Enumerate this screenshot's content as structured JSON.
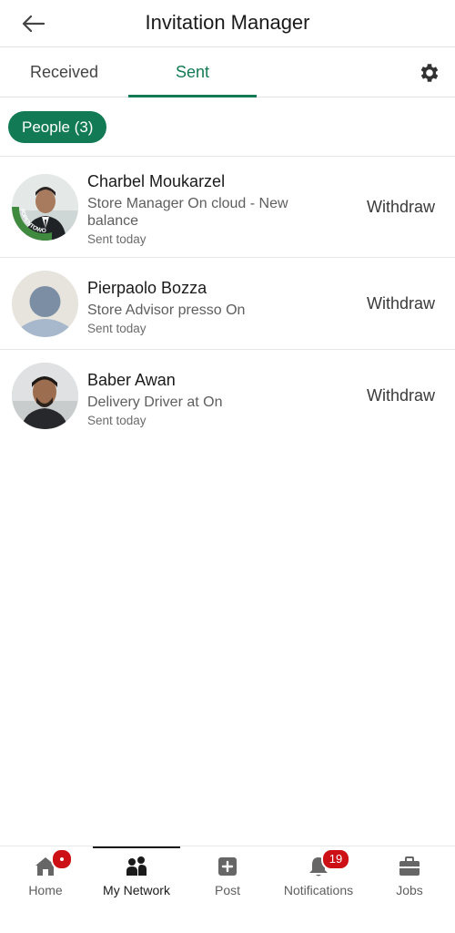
{
  "header": {
    "title": "Invitation Manager",
    "back_icon": "arrow-left-icon"
  },
  "tabs": [
    {
      "label": "Received",
      "active": false
    },
    {
      "label": "Sent",
      "active": true
    }
  ],
  "settings_icon": "gear-icon",
  "filter": {
    "label": "People (3)"
  },
  "invitations": [
    {
      "name": "Charbel Moukarzel",
      "headline": "Store Manager On cloud - New balance",
      "sent": "Sent today",
      "action": "Withdraw",
      "avatar": "photo-open-to-work",
      "avatar_frame_text": "#OPENTOWORK"
    },
    {
      "name": "Pierpaolo Bozza",
      "headline": "Store Advisor presso On",
      "sent": "Sent today",
      "action": "Withdraw",
      "avatar": "default-avatar"
    },
    {
      "name": "Baber Awan",
      "headline": "Delivery Driver at On",
      "sent": "Sent today",
      "action": "Withdraw",
      "avatar": "photo"
    }
  ],
  "bottom_nav": [
    {
      "label": "Home",
      "icon": "home-icon",
      "badge": "dot",
      "active": false
    },
    {
      "label": "My Network",
      "icon": "people-icon",
      "badge": "",
      "active": true
    },
    {
      "label": "Post",
      "icon": "plus-square-icon",
      "badge": "",
      "active": false
    },
    {
      "label": "Notifications",
      "icon": "bell-icon",
      "badge": "19",
      "active": false
    },
    {
      "label": "Jobs",
      "icon": "briefcase-icon",
      "badge": "",
      "active": false
    }
  ],
  "colors": {
    "accent": "#127a54",
    "badge": "#cc1016",
    "text": "#1a1a1a",
    "muted": "#5e5e5e"
  }
}
